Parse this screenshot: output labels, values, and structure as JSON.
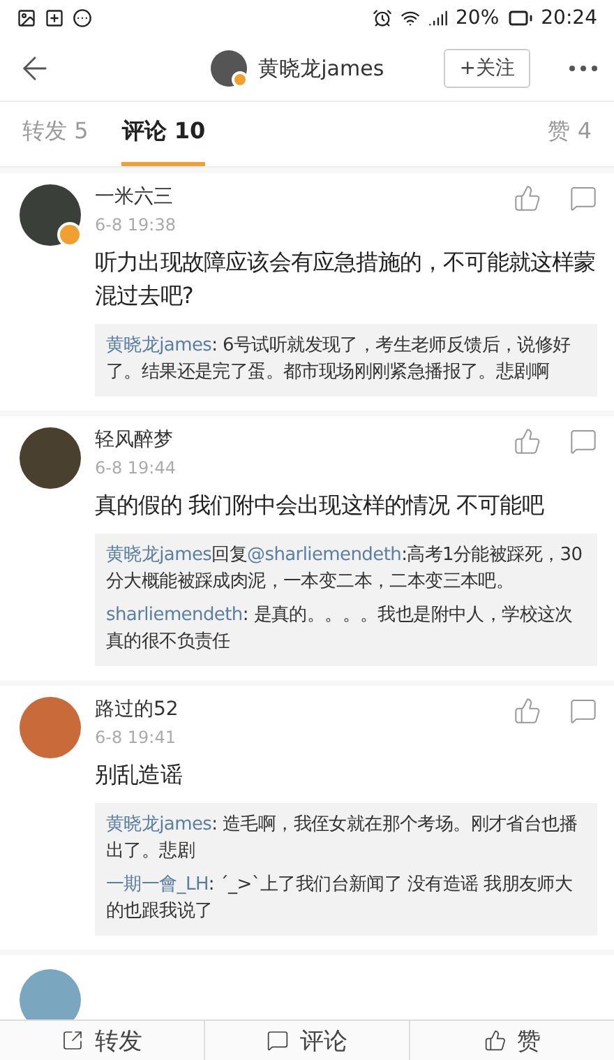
{
  "status_bar": {
    "battery": "20%",
    "time": "20:24"
  },
  "header": {
    "user": "黄晓龙james",
    "badge": true,
    "follow": "+关注"
  },
  "tabs": [
    {
      "label": "转发 5",
      "selected": false
    },
    {
      "label": "评论 10",
      "selected": true
    },
    {
      "label": "赞 4",
      "selected": false
    }
  ],
  "comments": [
    {
      "name": "一米六三",
      "badge": true,
      "time": "6-8 19:38",
      "text": "听力出现故障应该会有应急措施的，不可能就这样蒙混过去吧?",
      "replies": [
        {
          "author": "黄晓龙james",
          "text": ": 6号试听就发现了，考生老师反馈后，说修好了。结果还是完了蛋。都市现场刚刚紧急播报了。悲剧啊"
        }
      ]
    },
    {
      "name": "轻风醉梦",
      "badge": false,
      "time": "6-8 19:44",
      "text": "真的假的 我们附中会出现这样的情况 不可能吧",
      "replies": [
        {
          "author": "黄晓龙james",
          "verb": "回复",
          "target": "@sharliemendeth",
          "text": ":高考1分能被踩死，30分大概能被踩成肉泥，一本变二本，二本变三本吧。"
        },
        {
          "author": "sharliemendeth",
          "text": ": 是真的。。。。我也是附中人，学校这次真的很不负责任"
        }
      ]
    },
    {
      "name": "路过的52",
      "badge": false,
      "time": "6-8 19:41",
      "text": "别乱造谣",
      "replies": [
        {
          "author": "黄晓龙james",
          "text": ": 造毛啊，我侄女就在那个考场。刚才省台也播出了。悲剧"
        },
        {
          "author": "一期一會_LH",
          "text": ": ´_>`上了我们台新闻了 没有造谣 我朋友师大的也跟我说了"
        }
      ]
    }
  ],
  "bottom_bar": [
    {
      "kind": "repost",
      "label": "转发"
    },
    {
      "kind": "comment",
      "label": "评论"
    },
    {
      "kind": "like",
      "label": "赞"
    }
  ]
}
